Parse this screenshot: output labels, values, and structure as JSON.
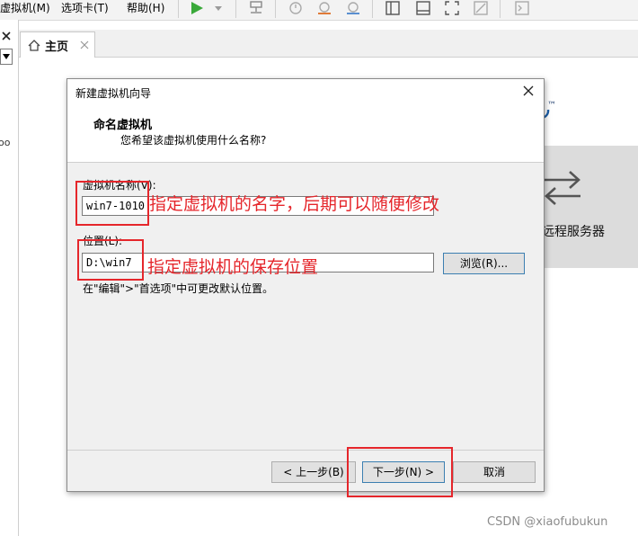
{
  "menubar": {
    "items": [
      "虚拟机(M)",
      "选项卡(T)",
      "帮助(H)"
    ]
  },
  "tabs": {
    "home_label": "主页"
  },
  "main": {
    "remote_label": "远程服务器",
    "tm_mark": "™"
  },
  "left_panel": {
    "text": "oo"
  },
  "dialog": {
    "title": "新建虚拟机向导",
    "heading": "命名虚拟机",
    "subheading": "您希望该虚拟机使用什么名称?",
    "name_label": "虚拟机名称(V):",
    "name_value": "win7-1010",
    "location_label": "位置(L):",
    "location_value": "D:\\win7",
    "browse_label": "浏览(R)...",
    "hint": "在\"编辑\">\"首选项\"中可更改默认位置。",
    "back_label": "< 上一步(B)",
    "next_label": "下一步(N) >",
    "cancel_label": "取消"
  },
  "annotations": {
    "name_note": "指定虚拟机的名字，后期可以随便修改",
    "location_note": "指定虚拟机的保存位置"
  },
  "watermark": "CSDN @xiaofubukun",
  "colors": {
    "annotation_red": "#e5262b",
    "play_green": "#3aa93a"
  }
}
